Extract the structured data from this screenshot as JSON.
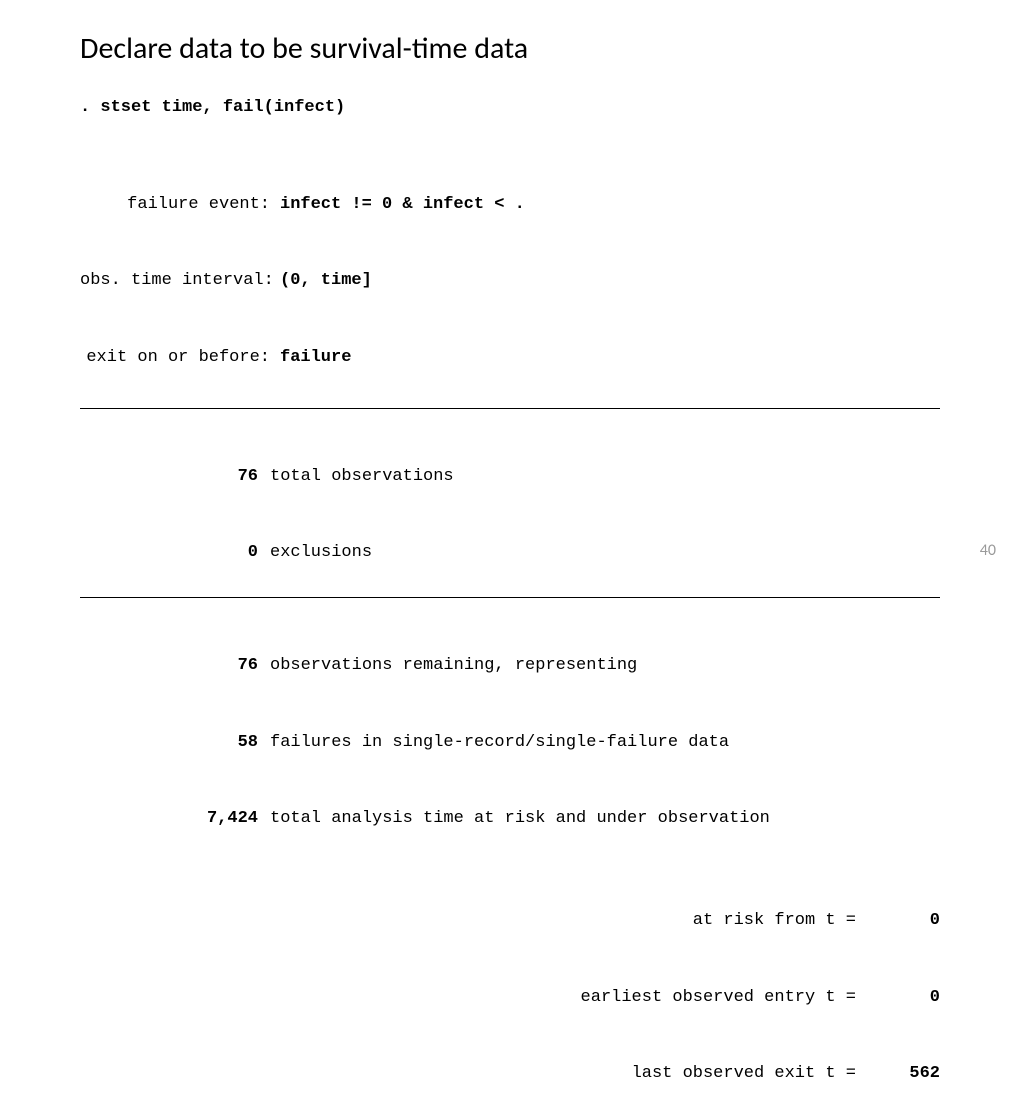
{
  "title": "Declare data to be survival-time data",
  "command": ". stset time, fail(infect)",
  "meta": [
    {
      "label": "failure event:",
      "value": "infect != 0 & infect < ."
    },
    {
      "label": "obs. time interval:",
      "value": "(0, time]"
    },
    {
      "label": "exit on or before:",
      "value": "failure"
    }
  ],
  "stats_top": [
    {
      "num": "76",
      "bold": false,
      "text": "total observations"
    },
    {
      "num": "0",
      "bold": false,
      "text": "exclusions"
    }
  ],
  "stats_bottom": [
    {
      "num": "76",
      "bold": false,
      "text": "observations remaining, representing"
    },
    {
      "num": "58",
      "bold": false,
      "text": "failures in single-record/single-failure data"
    },
    {
      "num": "7,424",
      "bold": true,
      "text": "total analysis time at risk and under observation"
    }
  ],
  "times": [
    {
      "label": "at risk from t =",
      "value": "0",
      "bold": false
    },
    {
      "label": "earliest observed entry t =",
      "value": "0",
      "bold": false
    },
    {
      "label": "last observed exit t =",
      "value": "562",
      "bold": true
    }
  ],
  "page_number": "40"
}
